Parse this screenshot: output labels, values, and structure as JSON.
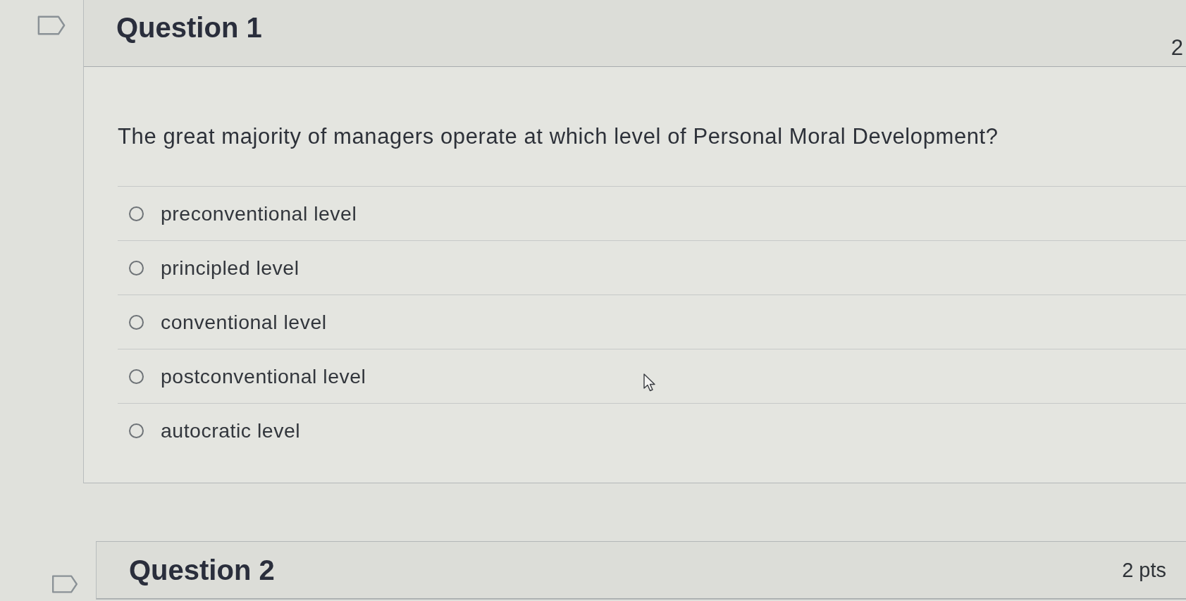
{
  "questions": [
    {
      "title": "Question 1",
      "points": "2",
      "prompt": "The great majority of managers operate at which level of Personal Moral Development?",
      "answers": [
        {
          "label": "preconventional level",
          "selected": false
        },
        {
          "label": "principled level",
          "selected": false
        },
        {
          "label": "conventional level",
          "selected": false
        },
        {
          "label": "postconventional level",
          "selected": false
        },
        {
          "label": "autocratic level",
          "selected": false
        }
      ]
    },
    {
      "title": "Question 2",
      "points": "2 pts"
    }
  ]
}
